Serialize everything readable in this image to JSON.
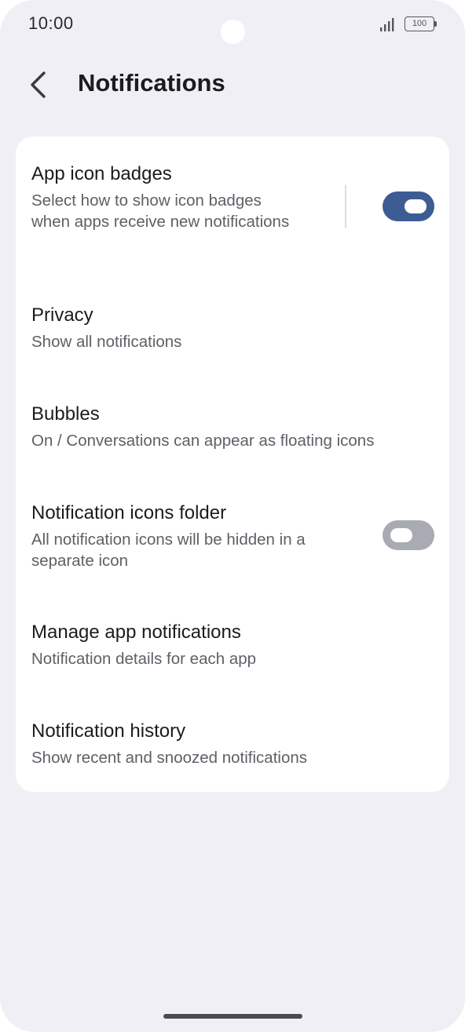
{
  "status_bar": {
    "time": "10:00",
    "battery": "100",
    "icons": [
      "signal-icon",
      "battery-icon"
    ]
  },
  "header": {
    "title": "Notifications",
    "back_icon": "chevron-left-icon"
  },
  "settings": {
    "items": [
      {
        "title": "App icon badges",
        "subtitle": "Select how to show icon badges when apps receive new notifications",
        "toggle": true
      },
      {
        "title": "Privacy",
        "subtitle": "Show all notifications"
      },
      {
        "title": "Bubbles",
        "subtitle": "On / Conversations can appear as floating icons"
      },
      {
        "title": "Notification icons folder",
        "subtitle": "All notification icons will be hidden in a separate icon",
        "toggle": false
      },
      {
        "title": "Manage app notifications",
        "subtitle": "Notification details for each app"
      },
      {
        "title": "Notification history",
        "subtitle": "Show recent and snoozed notifications"
      }
    ]
  },
  "colors": {
    "toggle_on": "#3d5c94",
    "toggle_off": "#a9abb3",
    "background": "#efeff5",
    "card": "#ffffff"
  }
}
